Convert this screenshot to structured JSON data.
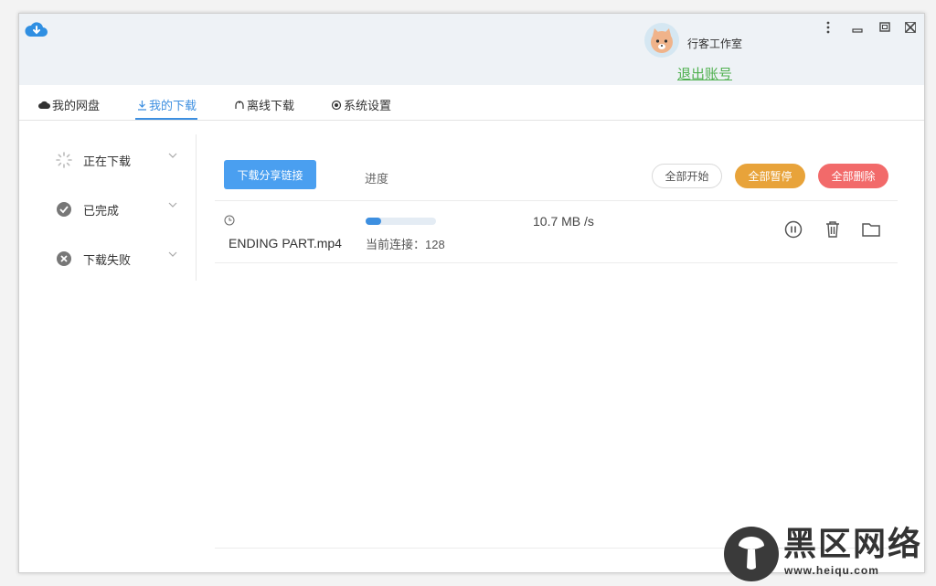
{
  "header": {
    "username": "行客工作室",
    "logout_label": "退出账号",
    "controls": [
      "more-icon",
      "minimize-icon",
      "restore-icon",
      "close-icon"
    ]
  },
  "tabs": [
    {
      "label": "我的网盘",
      "icon": "cloud-icon"
    },
    {
      "label": "我的下载",
      "icon": "download-icon",
      "active": true
    },
    {
      "label": "离线下载",
      "icon": "offline-icon"
    },
    {
      "label": "系统设置",
      "icon": "settings-icon"
    }
  ],
  "sidebar": {
    "items": [
      {
        "label": "正在下载",
        "icon": "spinner-icon"
      },
      {
        "label": "已完成",
        "icon": "check-circle-icon"
      },
      {
        "label": "下载失败",
        "icon": "x-circle-icon"
      }
    ]
  },
  "toolbar": {
    "share_link_label": "下载分享链接",
    "progress_header": "进度",
    "start_all_label": "全部开始",
    "pause_all_label": "全部暂停",
    "delete_all_label": "全部删除"
  },
  "downloads": [
    {
      "filename": "ENDING PART.mp4",
      "progress": 0.22,
      "connections_text": "当前连接：128",
      "speed": "10.7 MB /s"
    }
  ],
  "watermark": {
    "text": "黑区网络",
    "url": "www.heiqu.com"
  },
  "colors": {
    "accent": "#3d8fe0",
    "share_button": "#4a9ff0",
    "pause_all": "#e8a33a",
    "delete_all": "#f26a6a",
    "logout": "#4fb04f",
    "titlebar": "#eef2f6"
  }
}
